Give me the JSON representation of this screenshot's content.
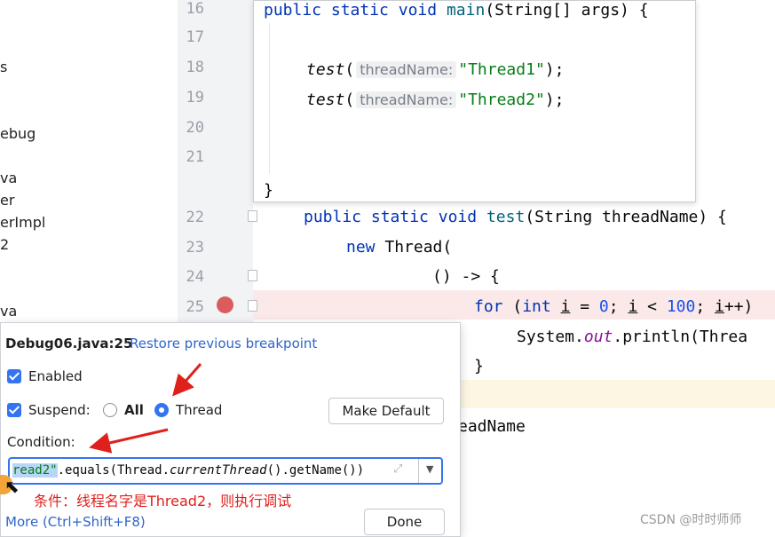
{
  "sidebar": {
    "items": [
      "s",
      "ebug",
      "va",
      "er",
      "erImpl",
      "2",
      "va"
    ]
  },
  "editor": {
    "line_numbers": [
      "16",
      "17",
      "18",
      "19",
      "20",
      "21",
      "22",
      "23",
      "24",
      "25"
    ],
    "popup": {
      "line16": {
        "kw1": "public",
        "kw2": "static",
        "kw3": "void",
        "name": "main",
        "rest": "(String[] args) {"
      },
      "line18": {
        "call": "test",
        "open": "(",
        "hint": "threadName:",
        "arg": "\"Thread1\"",
        "close": ");"
      },
      "line19": {
        "call": "test",
        "open": "(",
        "hint": "threadName:",
        "arg": "\"Thread2\"",
        "close": ");"
      },
      "closing": "}"
    },
    "line22": {
      "kw1": "public",
      "kw2": "static",
      "kw3": "void",
      "name": "test",
      "rest": "(String threadName) {"
    },
    "line23": {
      "kw": "new",
      "rest": "Thread("
    },
    "line24": {
      "text": "() -> {"
    },
    "line25": {
      "kw1": "for",
      "p1": " (",
      "kw2": "int",
      "v1": "i",
      "p2": " = ",
      "n1": "0",
      "p3": "; ",
      "v2": "i",
      "p4": " < ",
      "n2": "100",
      "p5": "; ",
      "v3": "i",
      "p6": "++)"
    },
    "line26": {
      "cls": "System.",
      "field": "out",
      "rest": ".println(Threa"
    },
    "line27": {
      "text": "}"
    },
    "line29": {
      "text": "eadName"
    }
  },
  "breakpoint_dialog": {
    "title": "Debug06.java:25",
    "restore_link": "Restore previous breakpoint",
    "enabled_label": "Enabled",
    "suspend_label": "Suspend:",
    "all_label": "All",
    "thread_label": "Thread",
    "make_default_button": "Make Default",
    "condition_label": "Condition:",
    "condition_selected": "read2\"",
    "condition_rest": ".equals(Thread.",
    "condition_italic": "currentThread",
    "condition_tail": "().getName())",
    "more_link": "More (Ctrl+Shift+F8)",
    "done_button": "Done",
    "suspend_mode": "Thread",
    "enabled_checked": true,
    "suspend_checked": true
  },
  "annotation": {
    "text": "条件：线程名字是Thread2，则执行调试",
    "color": "#e0201c"
  },
  "watermark": "CSDN @时时师师",
  "colors": {
    "keyword": "#0033b3",
    "string": "#067d17",
    "number": "#1750eb",
    "breakpoint": "#db5c5c",
    "accent": "#3574f0",
    "link": "#2f65ca"
  }
}
